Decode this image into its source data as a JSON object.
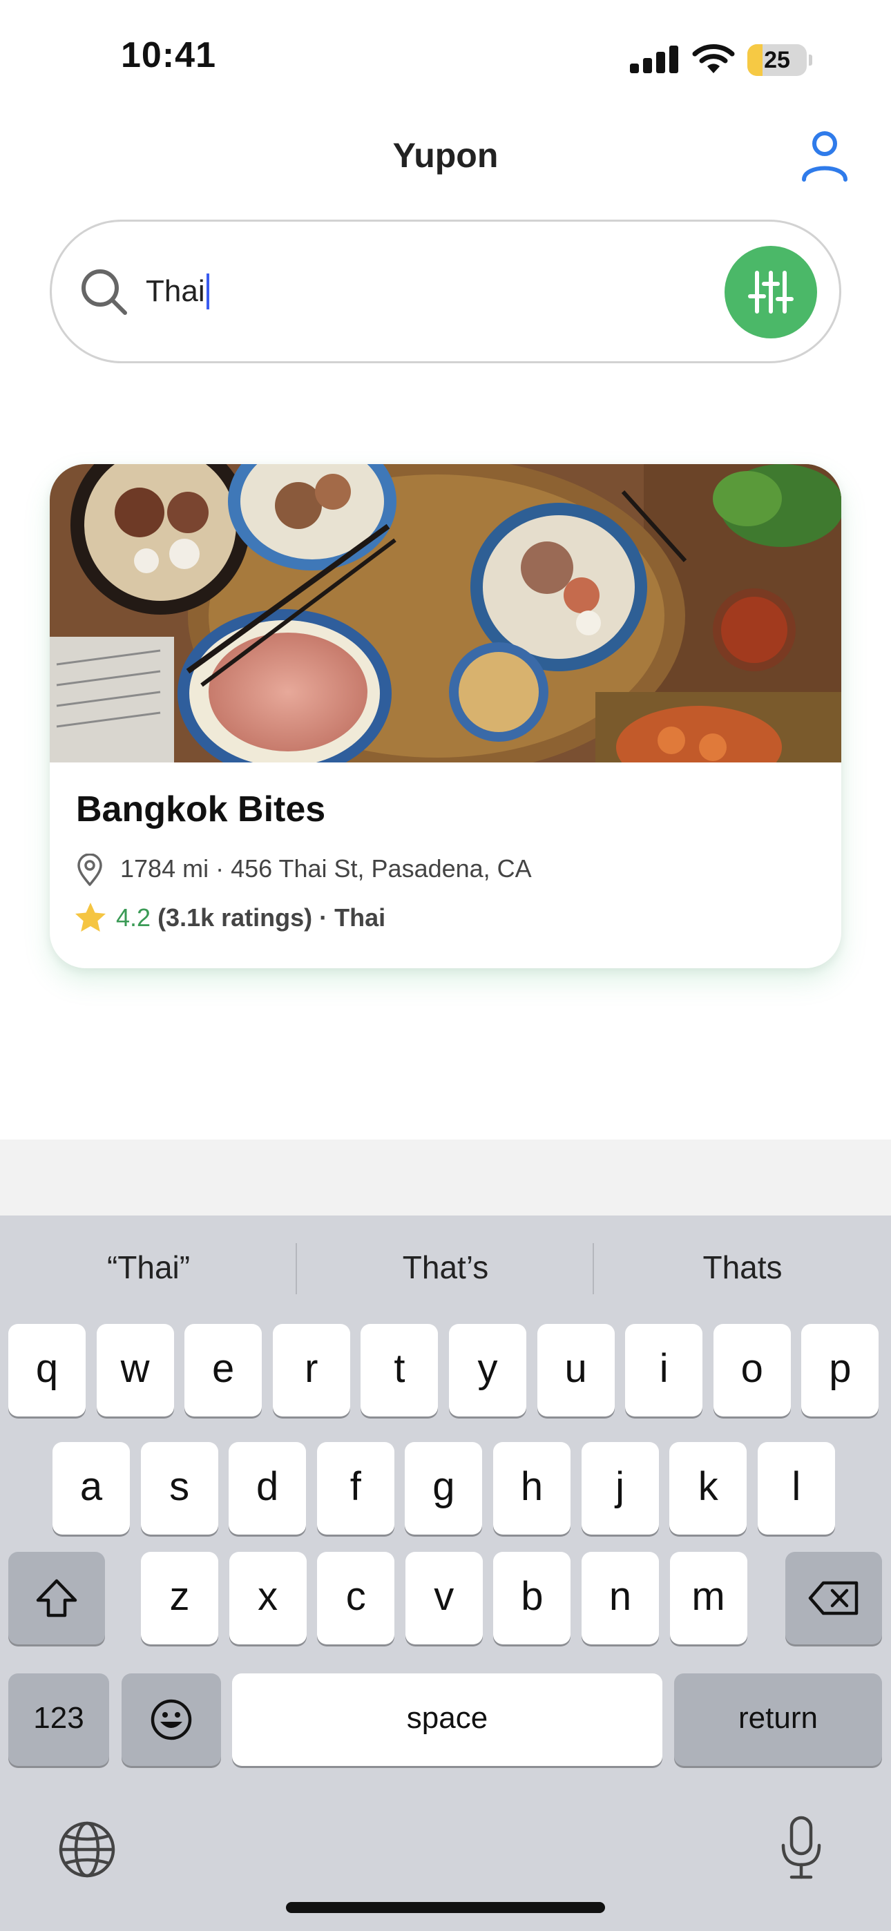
{
  "status_bar": {
    "time": "10:41",
    "battery_level": "25",
    "battery_fraction": 0.25,
    "icons": [
      "cellular-signal-icon",
      "wifi-icon",
      "battery-icon"
    ]
  },
  "header": {
    "title": "Yupon",
    "profile_icon": "person-icon"
  },
  "search": {
    "query": "Thai",
    "search_icon": "magnifier-icon",
    "filter_icon": "sliders-icon",
    "filter_color": "#4bb868"
  },
  "results": [
    {
      "name": "Bangkok Bites",
      "address": "1784 mi · 456 Thai St, Pasadena, CA",
      "rating": "4.2",
      "rating_count": "(3.1k ratings)",
      "separator": "·",
      "cuisine": "Thai",
      "image_description_icon": "food-photo"
    }
  ],
  "keyboard": {
    "suggestions": [
      "“Thai”",
      "That’s",
      "Thats"
    ],
    "row1": [
      "q",
      "w",
      "e",
      "r",
      "t",
      "y",
      "u",
      "i",
      "o",
      "p"
    ],
    "row2": [
      "a",
      "s",
      "d",
      "f",
      "g",
      "h",
      "j",
      "k",
      "l"
    ],
    "row3": [
      "z",
      "x",
      "c",
      "v",
      "b",
      "n",
      "m"
    ],
    "numbers_label": "123",
    "space_label": "space",
    "return_label": "return",
    "icons": [
      "shift-icon",
      "backspace-icon",
      "emoji-icon",
      "globe-icon",
      "microphone-icon"
    ]
  },
  "colors": {
    "accent_green": "#4bb868",
    "rating_green": "#3a9a55",
    "profile_blue": "#2f7bea",
    "star_yellow": "#f5c542",
    "keyboard_bg": "#d2d4da"
  }
}
